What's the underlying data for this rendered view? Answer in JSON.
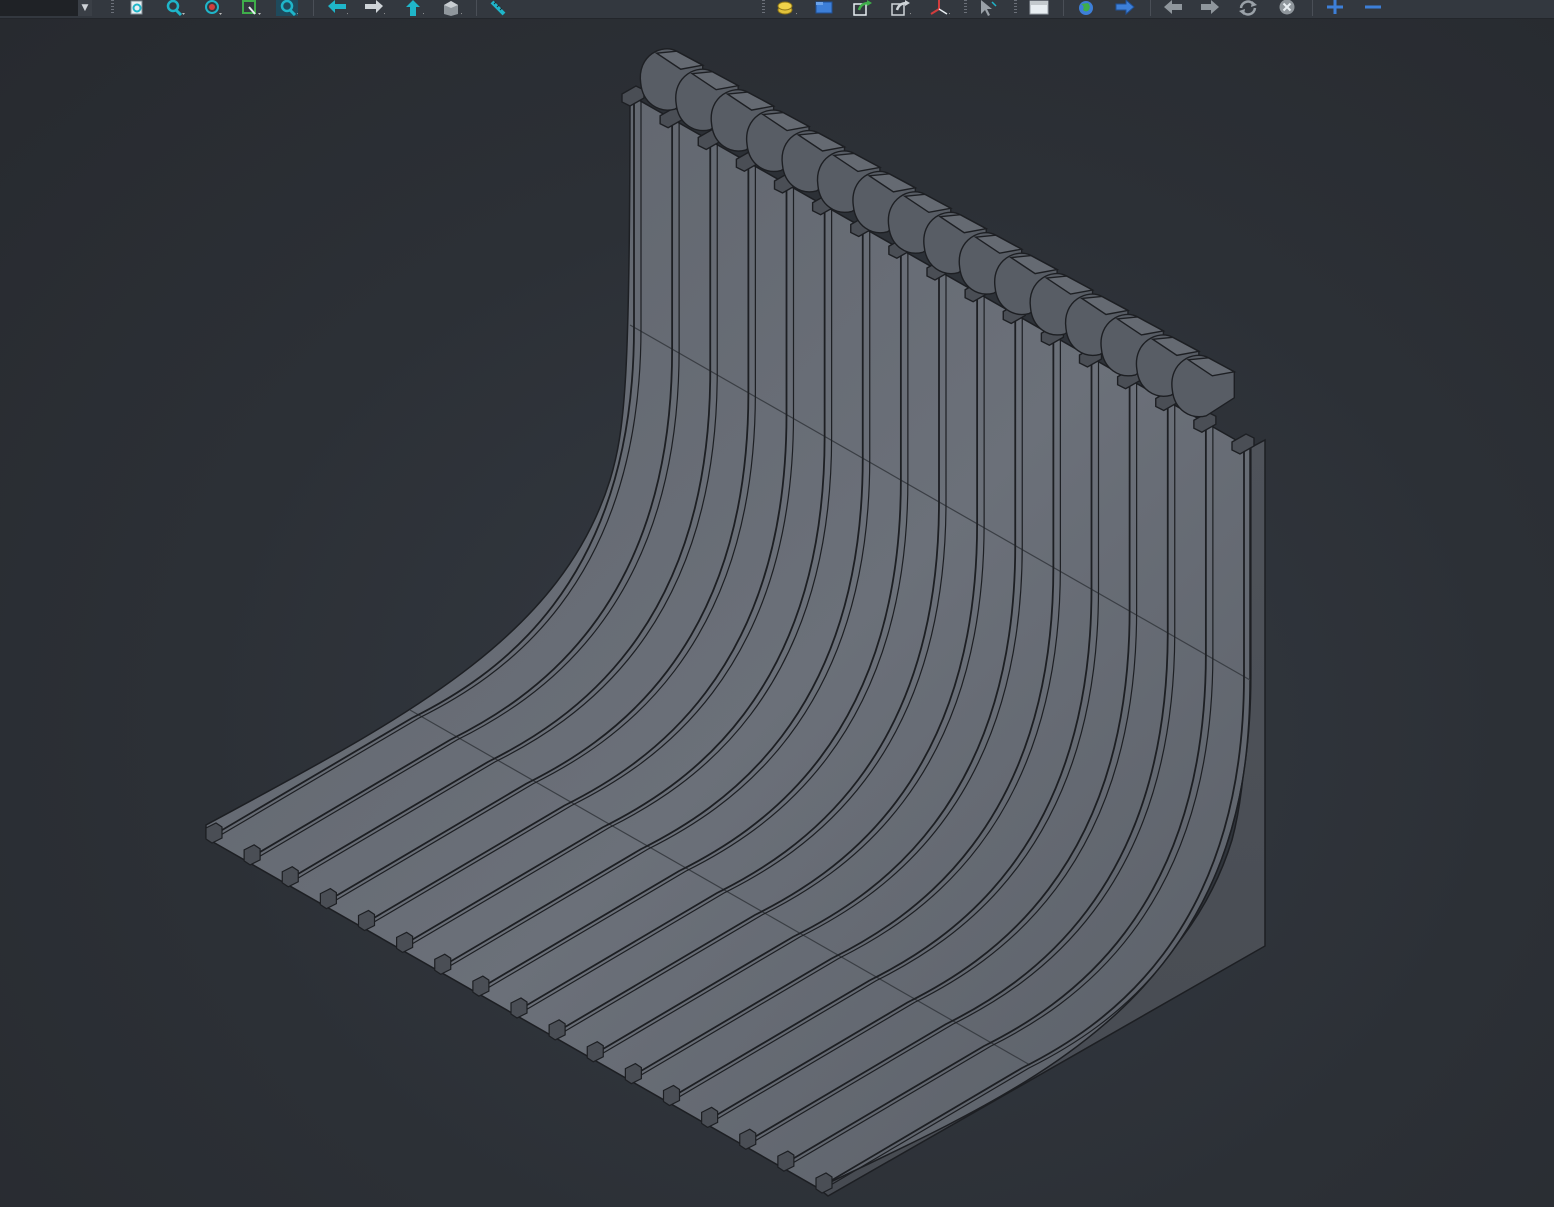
{
  "app": {
    "view_title": "",
    "visual_style": "Shaded"
  },
  "toolbar": {
    "workspace_value": "",
    "groups": [
      {
        "name": "zoom",
        "buttons": [
          "zoom-extents-icon",
          "zoom-realtime-icon",
          "zoom-previous-icon",
          "zoom-window-icon",
          "zoom-in-icon"
        ]
      },
      {
        "name": "view",
        "buttons": [
          "back-arrow-icon",
          "forward-arrow-icon",
          "up-arrow-icon",
          "view-cube-icon"
        ]
      },
      {
        "name": "measure",
        "buttons": [
          "measure-icon"
        ]
      },
      {
        "name": "layer",
        "buttons": [
          "layer-icon",
          "folder-icon",
          "share-icon",
          "export-icon",
          "axis-icon"
        ]
      },
      {
        "name": "select",
        "buttons": [
          "select-cursor-icon",
          "box-icon"
        ]
      },
      {
        "name": "web",
        "buttons": [
          "globe-icon",
          "send-arrow-icon"
        ]
      },
      {
        "name": "history",
        "buttons": [
          "previous-icon",
          "next-icon",
          "refresh-icon",
          "close-icon"
        ]
      },
      {
        "name": "scale",
        "buttons": [
          "plus-icon",
          "minus-icon"
        ]
      }
    ]
  },
  "model": {
    "description_colors": {
      "face_light": "#6a7079",
      "face_mid": "#5a5f67",
      "face_dark": "#474b52",
      "edge": "#1d1f23",
      "background": "#2b2f35"
    },
    "slat_count": 16
  },
  "colors": {
    "toolbar_bg": "#33383f",
    "accent_teal": "#1fb5c9",
    "accent_blue": "#3d7fd8",
    "accent_yellow": "#e2c23a"
  }
}
